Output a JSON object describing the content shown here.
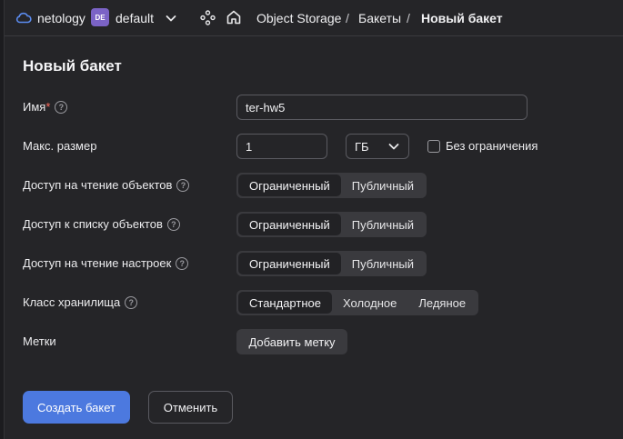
{
  "header": {
    "org_name": "netology",
    "folder_badge": "DE",
    "folder_name": "default",
    "breadcrumbs": [
      "Object Storage",
      "Бакеты",
      "Новый бакет"
    ],
    "separator": "/"
  },
  "page": {
    "title": "Новый бакет"
  },
  "form": {
    "name": {
      "label": "Имя",
      "required_mark": "*",
      "value": "ter-hw5"
    },
    "max_size": {
      "label": "Макс. размер",
      "value": "1",
      "unit": "ГБ",
      "unlimited_label": "Без ограничения",
      "unlimited_checked": false
    },
    "read_objects": {
      "label": "Доступ на чтение объектов",
      "options": [
        "Ограниченный",
        "Публичный"
      ],
      "selected": "Ограниченный"
    },
    "list_objects": {
      "label": "Доступ к списку объектов",
      "options": [
        "Ограниченный",
        "Публичный"
      ],
      "selected": "Ограниченный"
    },
    "read_settings": {
      "label": "Доступ на чтение настроек",
      "options": [
        "Ограниченный",
        "Публичный"
      ],
      "selected": "Ограниченный"
    },
    "storage_class": {
      "label": "Класс хранилища",
      "options": [
        "Стандартное",
        "Холодное",
        "Ледяное"
      ],
      "selected": "Стандартное"
    },
    "tags": {
      "label": "Метки",
      "add_label": "Добавить метку"
    }
  },
  "actions": {
    "create_label": "Создать бакет",
    "cancel_label": "Отменить"
  },
  "colors": {
    "background": "#252528",
    "primary": "#4c79df",
    "folder_badge": "#7b63c6",
    "required": "#ff6b5e"
  }
}
